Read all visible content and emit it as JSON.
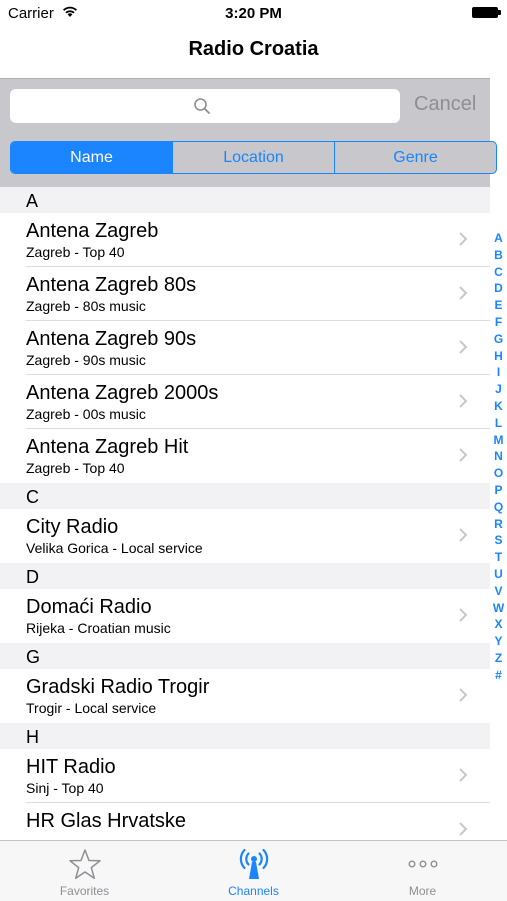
{
  "status_bar": {
    "carrier": "Carrier",
    "time": "3:20 PM"
  },
  "nav": {
    "title": "Radio Croatia"
  },
  "search": {
    "placeholder": "",
    "cancel_label": "Cancel"
  },
  "segments": [
    {
      "label": "Name",
      "selected": true
    },
    {
      "label": "Location",
      "selected": false
    },
    {
      "label": "Genre",
      "selected": false
    }
  ],
  "sections": [
    {
      "header": "A",
      "rows": [
        {
          "title": "Antena Zagreb",
          "subtitle": "Zagreb - Top 40"
        },
        {
          "title": "Antena Zagreb 80s",
          "subtitle": "Zagreb - 80s music"
        },
        {
          "title": "Antena Zagreb 90s",
          "subtitle": "Zagreb - 90s music"
        },
        {
          "title": "Antena Zagreb 2000s",
          "subtitle": "Zagreb - 00s music"
        },
        {
          "title": "Antena Zagreb Hit",
          "subtitle": "Zagreb - Top 40"
        }
      ]
    },
    {
      "header": "C",
      "rows": [
        {
          "title": "City Radio",
          "subtitle": "Velika Gorica - Local service"
        }
      ]
    },
    {
      "header": "D",
      "rows": [
        {
          "title": "Domaći Radio",
          "subtitle": "Rijeka - Croatian music"
        }
      ]
    },
    {
      "header": "G",
      "rows": [
        {
          "title": "Gradski Radio Trogir",
          "subtitle": "Trogir - Local service"
        }
      ]
    },
    {
      "header": "H",
      "rows": [
        {
          "title": "HIT Radio",
          "subtitle": "Sinj - Top 40"
        },
        {
          "title": "HR Glas Hrvatske",
          "subtitle": ""
        }
      ]
    }
  ],
  "index_letters": [
    "A",
    "B",
    "C",
    "D",
    "E",
    "F",
    "G",
    "H",
    "I",
    "J",
    "K",
    "L",
    "M",
    "N",
    "O",
    "P",
    "Q",
    "R",
    "S",
    "T",
    "U",
    "V",
    "W",
    "X",
    "Y",
    "Z",
    "#"
  ],
  "tabs": [
    {
      "label": "Favorites",
      "icon": "star-icon",
      "active": false
    },
    {
      "label": "Channels",
      "icon": "antenna-icon",
      "active": true
    },
    {
      "label": "More",
      "icon": "more-icon",
      "active": false
    }
  ],
  "colors": {
    "accent": "#1a85ff",
    "search_background": "#c8c7cc",
    "section_header": "#f2f2f4",
    "inactive_tab": "#8e8e93"
  }
}
